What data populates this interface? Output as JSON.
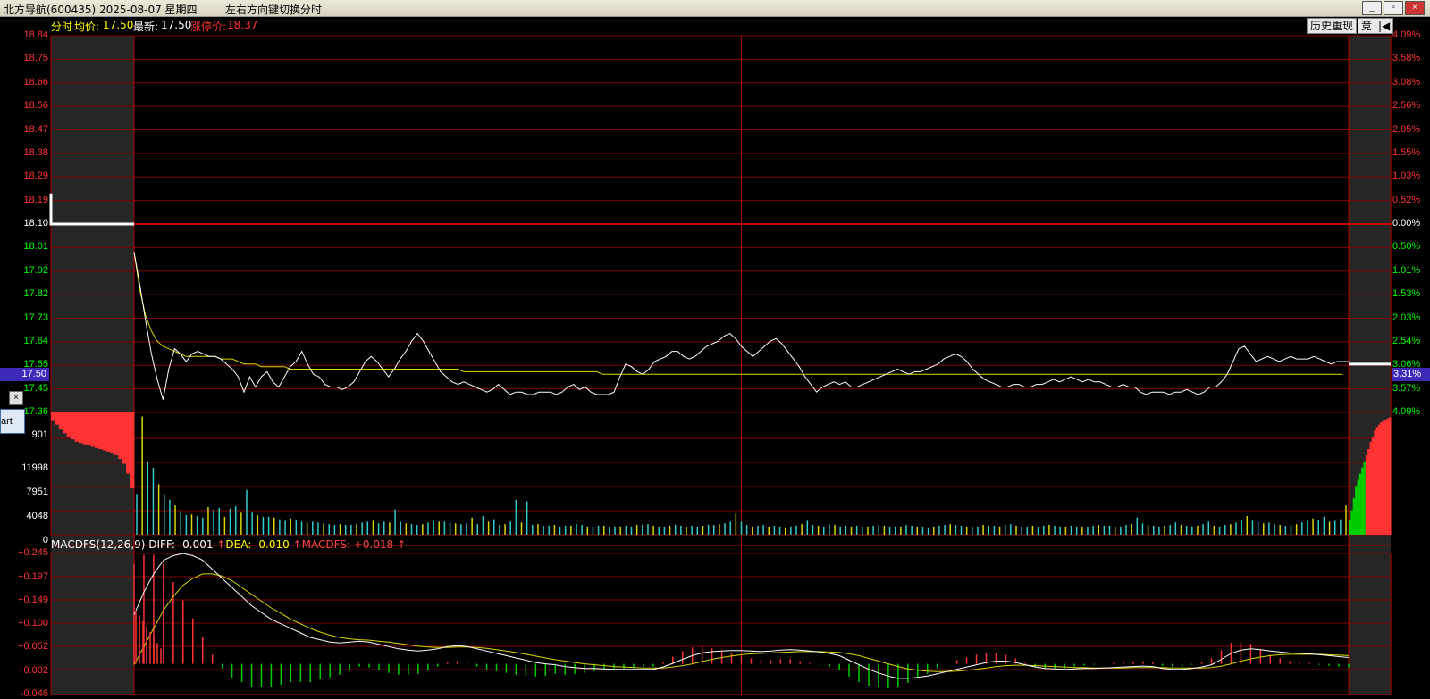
{
  "window": {
    "title": "北方导航(600435) 2025-08-07 星期四",
    "hint": "左右方向键切换分时",
    "controls": [
      "_",
      "▫",
      "×"
    ]
  },
  "header": {
    "mode": "分时",
    "avg_label": "均价:",
    "avg_value": "17.50",
    "last_label": "最新:",
    "last_value": "17.50",
    "limit_label": "涨停价:",
    "limit_value": "18.37",
    "history_button": "历史重现",
    "auction_button": "竞",
    "exit_button": "|◀"
  },
  "price_axis": {
    "left": [
      "18.84",
      "18.75",
      "18.66",
      "18.56",
      "18.47",
      "18.38",
      "18.29",
      "18.19",
      "18.10",
      "18.01",
      "17.92",
      "17.82",
      "17.73",
      "17.64",
      "17.55",
      "17.45",
      "17.36"
    ],
    "right": [
      "4.09%",
      "3.58%",
      "3.08%",
      "2.56%",
      "2.05%",
      "1.55%",
      "1.03%",
      "0.52%",
      "0.00%",
      "0.50%",
      "1.01%",
      "1.53%",
      "2.03%",
      "2.54%",
      "3.06%",
      "3.57%",
      "4.09%"
    ],
    "current_price": "17.50",
    "current_pct": "3.31%",
    "prev_close": 18.1
  },
  "volume_axis": [
    "901",
    "11998",
    "7951",
    "4048",
    "0"
  ],
  "macd": {
    "label": "MACDFS(12,26,9)",
    "diff_label": "DIFF:",
    "diff_value": "-0.001",
    "dea_label": "DEA:",
    "dea_value": "-0.010",
    "macdfs_label": "MACDFS:",
    "macdfs_value": "+0.018",
    "arrow": "↑",
    "axis": [
      "+0.245",
      "+0.197",
      "+0.149",
      "+0.100",
      "+0.052",
      "+0.002",
      "-0.046"
    ]
  },
  "popup": {
    "close": "×",
    "button": "art"
  },
  "chart_data": {
    "type": "line",
    "series": [
      {
        "values": [
          17.99,
          17.86,
          17.72,
          17.59,
          17.49,
          17.41,
          17.53,
          17.61,
          17.59,
          17.56,
          17.59,
          17.6,
          17.59,
          17.58,
          17.58,
          17.57,
          17.55,
          17.53,
          17.5,
          17.44,
          17.5,
          17.46,
          17.5,
          17.52,
          17.48,
          17.46,
          17.5,
          17.54,
          17.56,
          17.6,
          17.55,
          17.51,
          17.5,
          17.47,
          17.46,
          17.46,
          17.45,
          17.46,
          17.48,
          17.52,
          17.56,
          17.58,
          17.56,
          17.53,
          17.5,
          17.53,
          17.57,
          17.6,
          17.64,
          17.67,
          17.64,
          17.6,
          17.56,
          17.52,
          17.5,
          17.48,
          17.47,
          17.48,
          17.47,
          17.46,
          17.45,
          17.44,
          17.45,
          17.47,
          17.45,
          17.43,
          17.44,
          17.44,
          17.43,
          17.43,
          17.44,
          17.44,
          17.44,
          17.43,
          17.44,
          17.46,
          17.47,
          17.45,
          17.46,
          17.44,
          17.43,
          17.43,
          17.43,
          17.44,
          17.5,
          17.55,
          17.54,
          17.52,
          17.51,
          17.53,
          17.56,
          17.57,
          17.58,
          17.6,
          17.6,
          17.58,
          17.57,
          17.58,
          17.6,
          17.62,
          17.63,
          17.64,
          17.66,
          17.67,
          17.65,
          17.62,
          17.6,
          17.58,
          17.6,
          17.62,
          17.64,
          17.65,
          17.63,
          17.6,
          17.57,
          17.54,
          17.5,
          17.47,
          17.44,
          17.46,
          17.47,
          17.48,
          17.47,
          17.48,
          17.46,
          17.46,
          17.47,
          17.48,
          17.49,
          17.5,
          17.51,
          17.52,
          17.53,
          17.52,
          17.51,
          17.52,
          17.52,
          17.53,
          17.54,
          17.55,
          17.57,
          17.58,
          17.59,
          17.58,
          17.56,
          17.53,
          17.51,
          17.49,
          17.48,
          17.47,
          17.46,
          17.46,
          17.47,
          17.47,
          17.46,
          17.46,
          17.47,
          17.47,
          17.48,
          17.49,
          17.48,
          17.49,
          17.5,
          17.49,
          17.48,
          17.49,
          17.48,
          17.48,
          17.47,
          17.46,
          17.46,
          17.47,
          17.46,
          17.46,
          17.44,
          17.43,
          17.44,
          17.44,
          17.44,
          17.43,
          17.44,
          17.44,
          17.45,
          17.44,
          17.43,
          17.44,
          17.46,
          17.46,
          17.48,
          17.51,
          17.56,
          17.61,
          17.62,
          17.59,
          17.56,
          17.57,
          17.58,
          17.57,
          17.56,
          17.57,
          17.58,
          17.57,
          17.57,
          17.57,
          17.58,
          17.57,
          17.56,
          17.55,
          17.56,
          17.56,
          17.56
        ]
      },
      {
        "values": [
          17.99,
          17.84,
          17.74,
          17.68,
          17.64,
          17.62,
          17.61,
          17.6,
          17.59,
          17.58,
          17.58,
          17.58,
          17.58,
          17.58,
          17.58,
          17.57,
          17.57,
          17.57,
          17.56,
          17.55,
          17.55,
          17.55,
          17.54,
          17.54,
          17.54,
          17.54,
          17.54,
          17.53,
          17.53,
          17.53,
          17.53,
          17.53,
          17.53,
          17.53,
          17.53,
          17.53,
          17.53,
          17.53,
          17.53,
          17.53,
          17.53,
          17.53,
          17.53,
          17.53,
          17.53,
          17.53,
          17.53,
          17.53,
          17.53,
          17.53,
          17.53,
          17.53,
          17.53,
          17.53,
          17.53,
          17.53,
          17.53,
          17.52,
          17.52,
          17.52,
          17.52,
          17.52,
          17.52,
          17.52,
          17.52,
          17.52,
          17.52,
          17.52,
          17.52,
          17.52,
          17.52,
          17.52,
          17.52,
          17.52,
          17.52,
          17.52,
          17.52,
          17.52,
          17.52,
          17.52,
          17.52,
          17.51,
          17.51,
          17.51,
          17.51,
          17.51,
          17.51,
          17.51,
          17.51,
          17.51,
          17.51,
          17.51,
          17.51,
          17.51,
          17.51,
          17.51,
          17.51,
          17.51,
          17.51,
          17.51,
          17.51,
          17.51,
          17.51,
          17.51,
          17.51,
          17.51,
          17.51,
          17.51,
          17.51,
          17.51,
          17.51,
          17.51,
          17.51,
          17.51,
          17.51,
          17.51,
          17.51,
          17.51,
          17.51,
          17.51,
          17.51,
          17.51,
          17.51,
          17.51,
          17.51,
          17.51,
          17.51,
          17.51,
          17.51,
          17.51,
          17.51,
          17.51,
          17.51,
          17.51,
          17.51,
          17.51,
          17.51,
          17.51,
          17.51,
          17.51,
          17.51,
          17.51,
          17.51,
          17.51,
          17.51,
          17.51,
          17.51,
          17.51,
          17.51,
          17.51,
          17.51,
          17.51,
          17.51,
          17.51,
          17.51,
          17.51,
          17.51,
          17.51,
          17.51,
          17.51,
          17.51,
          17.51,
          17.51,
          17.51,
          17.51,
          17.51,
          17.51,
          17.51,
          17.51,
          17.51,
          17.51,
          17.51,
          17.51,
          17.51,
          17.51,
          17.51,
          17.51,
          17.51,
          17.51,
          17.51,
          17.51,
          17.51,
          17.51,
          17.51,
          17.51,
          17.51,
          17.51,
          17.51,
          17.51,
          17.51,
          17.51,
          17.51,
          17.51,
          17.51,
          17.51,
          17.51,
          17.51,
          17.51,
          17.51,
          17.51,
          17.51,
          17.51,
          17.51,
          17.51,
          17.51,
          17.51,
          17.51,
          17.51,
          17.51,
          17.51
        ]
      }
    ],
    "ylim": [
      17.36,
      18.84
    ],
    "volume": [
      5000,
      14500,
      9000,
      8200,
      6200,
      5000,
      4300,
      3600,
      2900,
      2400,
      2500,
      2300,
      2100,
      3400,
      3100,
      3300,
      2200,
      3200,
      3500,
      2700,
      5500,
      2700,
      2400,
      2200,
      2200,
      2100,
      1900,
      1700,
      2000,
      1800,
      1600,
      1500,
      1600,
      1500,
      1400,
      1300,
      1200,
      1300,
      1200,
      1200,
      1300,
      1500,
      1600,
      1700,
      1400,
      1600,
      1500,
      3100,
      1600,
      1400,
      1300,
      1200,
      1300,
      1500,
      1700,
      1600,
      1600,
      1500,
      1400,
      1300,
      1400,
      2100,
      1300,
      2300,
      1600,
      1900,
      1200,
      1300,
      1600,
      4300,
      1500,
      4100,
      1200,
      1300,
      1100,
      1100,
      1200,
      1000,
      1100,
      1100,
      1300,
      1200,
      1000,
      1000,
      1100,
      1100,
      1000,
      1000,
      1000,
      1100,
      1000,
      1200,
      1200,
      1300,
      1100,
      1000,
      1000,
      1100,
      1200,
      1100,
      1000,
      1100,
      1000,
      1100,
      1200,
      1200,
      1300,
      1400,
      1600,
      2600,
      1600,
      1200,
      1000,
      1100,
      1200,
      1000,
      1100,
      1000,
      900,
      1000,
      1100,
      1300,
      1700,
      1200,
      1100,
      1000,
      1300,
      1200,
      1000,
      1100,
      1000,
      1100,
      1000,
      1000,
      1100,
      1200,
      1100,
      1000,
      1000,
      1000,
      1200,
      1100,
      1000,
      1000,
      900,
      1000,
      1100,
      1200,
      1300,
      1200,
      1100,
      1000,
      1000,
      1000,
      1200,
      1100,
      1100,
      1000,
      1200,
      1300,
      1100,
      1000,
      1000,
      1100,
      1000,
      1100,
      1200,
      1100,
      1000,
      1000,
      1100,
      1000,
      1000,
      1000,
      1100,
      1200,
      1100,
      1100,
      1000,
      1000,
      1200,
      1300,
      2100,
      1400,
      1200,
      1100,
      1000,
      1100,
      1200,
      1500,
      1200,
      1100,
      1000,
      1100,
      1300,
      1600,
      1100,
      1000,
      1200,
      1300,
      1500,
      1800,
      2300,
      1700,
      1600,
      1400,
      1500,
      1300,
      1200,
      1100,
      1200,
      1300,
      1500,
      1700,
      2000,
      1800,
      2200,
      1600,
      1700,
      1900,
      3600
    ],
    "macd": {
      "diff": [
        0.11,
        0.16,
        0.2,
        0.23,
        0.24,
        0.245,
        0.24,
        0.23,
        0.21,
        0.19,
        0.17,
        0.15,
        0.13,
        0.115,
        0.1,
        0.09,
        0.08,
        0.07,
        0.06,
        0.055,
        0.05,
        0.048,
        0.05,
        0.052,
        0.05,
        0.045,
        0.04,
        0.035,
        0.032,
        0.03,
        0.032,
        0.035,
        0.04,
        0.042,
        0.04,
        0.035,
        0.03,
        0.025,
        0.02,
        0.015,
        0.01,
        0.005,
        0.002,
        0.0,
        -0.004,
        -0.006,
        -0.008,
        -0.008,
        -0.009,
        -0.01,
        -0.01,
        -0.01,
        -0.01,
        -0.01,
        -0.005,
        0.003,
        0.012,
        0.02,
        0.026,
        0.029,
        0.03,
        0.031,
        0.031,
        0.03,
        0.029,
        0.03,
        0.032,
        0.033,
        0.032,
        0.03,
        0.028,
        0.025,
        0.02,
        0.01,
        0.0,
        -0.01,
        -0.018,
        -0.025,
        -0.03,
        -0.03,
        -0.028,
        -0.025,
        -0.02,
        -0.015,
        -0.01,
        -0.005,
        0.0,
        0.005,
        0.008,
        0.008,
        0.005,
        0.0,
        -0.005,
        -0.008,
        -0.009,
        -0.01,
        -0.009,
        -0.008,
        -0.008,
        -0.007,
        -0.006,
        -0.005,
        -0.004,
        -0.003,
        -0.004,
        -0.008,
        -0.01,
        -0.01,
        -0.008,
        -0.005,
        0.0,
        0.012,
        0.025,
        0.032,
        0.035,
        0.033,
        0.03,
        0.028,
        0.026,
        0.025,
        0.024,
        0.022,
        0.02,
        0.018,
        0.016
      ],
      "dea": [
        0.0,
        0.04,
        0.08,
        0.12,
        0.15,
        0.175,
        0.19,
        0.2,
        0.2,
        0.195,
        0.185,
        0.17,
        0.155,
        0.14,
        0.125,
        0.113,
        0.1,
        0.09,
        0.08,
        0.072,
        0.065,
        0.06,
        0.057,
        0.055,
        0.054,
        0.052,
        0.05,
        0.047,
        0.044,
        0.041,
        0.039,
        0.038,
        0.038,
        0.039,
        0.039,
        0.038,
        0.036,
        0.033,
        0.03,
        0.027,
        0.023,
        0.019,
        0.015,
        0.011,
        0.008,
        0.005,
        0.002,
        0.0,
        -0.002,
        -0.004,
        -0.005,
        -0.006,
        -0.007,
        -0.007,
        -0.007,
        -0.005,
        -0.002,
        0.002,
        0.007,
        0.012,
        0.016,
        0.019,
        0.022,
        0.024,
        0.025,
        0.026,
        0.027,
        0.028,
        0.029,
        0.029,
        0.029,
        0.028,
        0.027,
        0.024,
        0.02,
        0.014,
        0.008,
        0.002,
        -0.004,
        -0.009,
        -0.012,
        -0.014,
        -0.015,
        -0.015,
        -0.014,
        -0.012,
        -0.01,
        -0.007,
        -0.004,
        -0.002,
        -0.001,
        -0.001,
        -0.002,
        -0.003,
        -0.004,
        -0.005,
        -0.006,
        -0.006,
        -0.007,
        -0.007,
        -0.007,
        -0.007,
        -0.006,
        -0.006,
        -0.006,
        -0.006,
        -0.007,
        -0.007,
        -0.007,
        -0.007,
        -0.006,
        -0.003,
        0.002,
        0.008,
        0.013,
        0.017,
        0.02,
        0.022,
        0.023,
        0.023,
        0.023,
        0.023,
        0.022,
        0.021,
        0.02
      ],
      "ylim": [
        -0.046,
        0.245
      ]
    },
    "pre_auction_volume_fraction": [
      0.93,
      0.9,
      0.86,
      0.83,
      0.8,
      0.78,
      0.76,
      0.75,
      0.74,
      0.73,
      0.72,
      0.71,
      0.7,
      0.69,
      0.68,
      0.67,
      0.65,
      0.62,
      0.58,
      0.5,
      0.38
    ],
    "post_auction_volume_fraction": [
      0.12,
      0.2,
      0.3,
      0.4,
      0.45,
      0.5,
      0.55,
      0.6,
      0.65,
      0.7,
      0.76,
      0.8,
      0.85,
      0.88,
      0.9,
      0.92,
      0.93,
      0.94,
      0.95,
      0.96
    ]
  }
}
